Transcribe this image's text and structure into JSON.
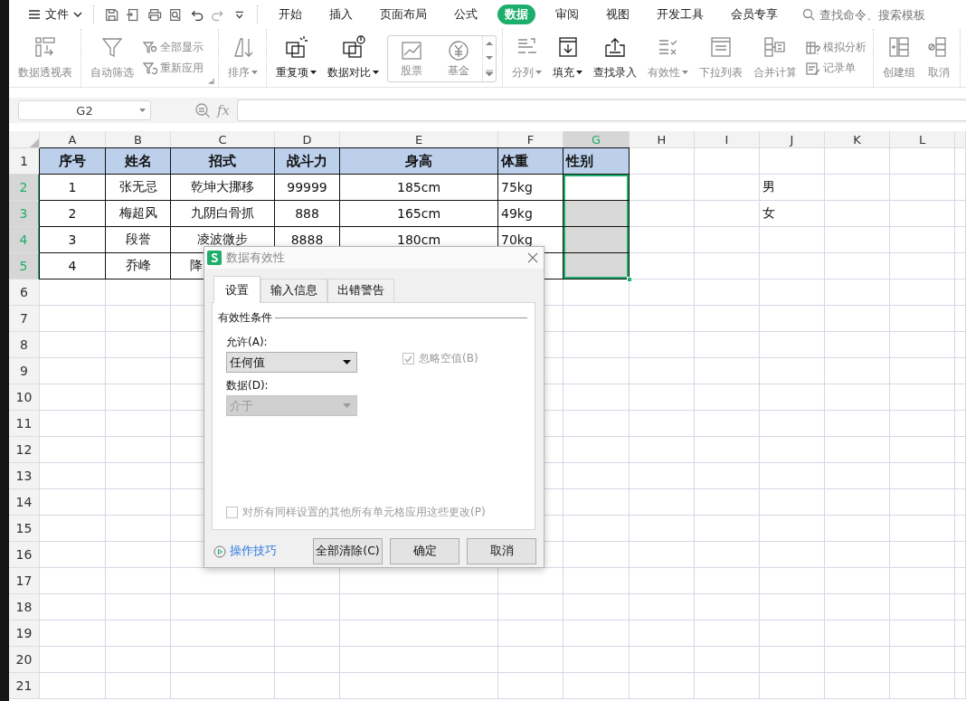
{
  "top_bar": {
    "file_menu": "文件",
    "tabs": [
      {
        "label": "开始",
        "selected": false
      },
      {
        "label": "插入",
        "selected": false
      },
      {
        "label": "页面布局",
        "selected": false
      },
      {
        "label": "公式",
        "selected": false
      },
      {
        "label": "数据",
        "selected": true
      },
      {
        "label": "审阅",
        "selected": false
      },
      {
        "label": "视图",
        "selected": false
      },
      {
        "label": "开发工具",
        "selected": false
      },
      {
        "label": "会员专享",
        "selected": false
      }
    ],
    "search": {
      "placeholder": "查找命令、搜索模板"
    }
  },
  "ribbon": [
    {
      "items": [
        {
          "kind": "large",
          "label": "数据透视表",
          "disabled": true,
          "dropdown": false
        }
      ]
    },
    {
      "launcher": true,
      "items": [
        {
          "kind": "large",
          "label": "自动筛选",
          "disabled": true,
          "dropdown": false
        },
        {
          "kind": "stack",
          "items": [
            {
              "label": "全部显示",
              "disabled": true
            },
            {
              "label": "重新应用",
              "disabled": true
            }
          ]
        }
      ]
    },
    {
      "items": [
        {
          "kind": "large",
          "label": "排序",
          "disabled": true,
          "dropdown": true
        }
      ]
    },
    {
      "items": [
        {
          "kind": "large",
          "label": "重复项",
          "disabled": false,
          "dropdown": true
        },
        {
          "kind": "large",
          "label": "数据对比",
          "disabled": false,
          "dropdown": true
        },
        {
          "kind": "gallery",
          "items": [
            {
              "label": "股票",
              "disabled": true
            },
            {
              "label": "基金",
              "disabled": true
            }
          ]
        }
      ]
    },
    {
      "items": [
        {
          "kind": "large",
          "label": "分列",
          "disabled": true,
          "dropdown": true
        },
        {
          "kind": "large",
          "label": "填充",
          "disabled": false,
          "dropdown": true
        },
        {
          "kind": "large",
          "label": "查找录入",
          "disabled": false,
          "dropdown": false
        },
        {
          "kind": "large",
          "label": "有效性",
          "disabled": true,
          "dropdown": true
        },
        {
          "kind": "large",
          "label": "下拉列表",
          "disabled": true,
          "dropdown": false
        },
        {
          "kind": "large",
          "label": "合并计算",
          "disabled": true,
          "dropdown": false
        },
        {
          "kind": "stack",
          "items": [
            {
              "label": "模拟分析",
              "disabled": true
            },
            {
              "label": "记录单",
              "disabled": true
            }
          ]
        }
      ]
    },
    {
      "items": [
        {
          "kind": "large",
          "label": "创建组",
          "disabled": true,
          "dropdown": false
        },
        {
          "kind": "large",
          "label": "取消",
          "disabled": true,
          "dropdown": false
        }
      ]
    }
  ],
  "formula_bar": {
    "name_box": "G2",
    "function_label": "fx"
  },
  "sheet": {
    "columns": [
      {
        "label": "A",
        "selected": false
      },
      {
        "label": "B",
        "selected": false
      },
      {
        "label": "C",
        "selected": false
      },
      {
        "label": "D",
        "selected": false
      },
      {
        "label": "E",
        "selected": false
      },
      {
        "label": "F",
        "selected": false
      },
      {
        "label": "G",
        "selected": true
      },
      {
        "label": "H",
        "selected": false
      },
      {
        "label": "I",
        "selected": false
      },
      {
        "label": "J",
        "selected": false
      },
      {
        "label": "K",
        "selected": false
      },
      {
        "label": "L",
        "selected": false
      }
    ],
    "rows": [
      {
        "number": "1",
        "selected": false,
        "kind": "header",
        "cells": [
          "序号",
          "姓名",
          "招式",
          "战斗力",
          "身高",
          "体重",
          "性别"
        ]
      },
      {
        "number": "2",
        "selected": true,
        "kind": "data",
        "cells": [
          "1",
          "张无忌",
          "乾坤大挪移",
          "99999",
          "185cm",
          "75kg",
          null,
          null,
          null,
          "男"
        ]
      },
      {
        "number": "3",
        "selected": true,
        "kind": "data",
        "cells": [
          "2",
          "梅超风",
          "九阴白骨抓",
          "888",
          "165cm",
          "49kg",
          null,
          null,
          null,
          "女"
        ]
      },
      {
        "number": "4",
        "selected": true,
        "kind": "data",
        "cells": [
          "3",
          "段誉",
          "凌波微步",
          "8888",
          "180cm",
          "70kg",
          null
        ]
      },
      {
        "number": "5",
        "selected": true,
        "kind": "data",
        "cells": [
          "4",
          "乔峰",
          "降",
          null,
          null,
          null,
          null
        ]
      },
      {
        "number": "6",
        "selected": false
      },
      {
        "number": "7",
        "selected": false
      },
      {
        "number": "8",
        "selected": false
      },
      {
        "number": "9",
        "selected": false
      },
      {
        "number": "10",
        "selected": false
      },
      {
        "number": "11",
        "selected": false
      },
      {
        "number": "12",
        "selected": false
      },
      {
        "number": "13",
        "selected": false
      },
      {
        "number": "14",
        "selected": false
      },
      {
        "number": "15",
        "selected": false
      },
      {
        "number": "16",
        "selected": false
      },
      {
        "number": "17",
        "selected": false
      },
      {
        "number": "18",
        "selected": false
      },
      {
        "number": "19",
        "selected": false
      },
      {
        "number": "20",
        "selected": false
      },
      {
        "number": "21",
        "selected": false
      }
    ]
  },
  "dialog": {
    "title": "数据有效性",
    "tabs": [
      {
        "label": "设置",
        "selected": true
      },
      {
        "label": "输入信息",
        "selected": false
      },
      {
        "label": "出错警告",
        "selected": false
      }
    ],
    "section": "有效性条件",
    "allow": {
      "label": "允许(A):",
      "value": "任何值",
      "disabled": false
    },
    "ignore_blank": {
      "label": "忽略空值(B)",
      "checked": true,
      "disabled": true
    },
    "data": {
      "label": "数据(D):",
      "value": "介于",
      "disabled": true
    },
    "apply_all": {
      "label": "对所有同样设置的其他所有单元格应用这些更改(P)",
      "checked": false,
      "disabled": true
    },
    "help_link": "操作技巧",
    "buttons": [
      "全部清除(C)",
      "确定",
      "取消"
    ]
  }
}
